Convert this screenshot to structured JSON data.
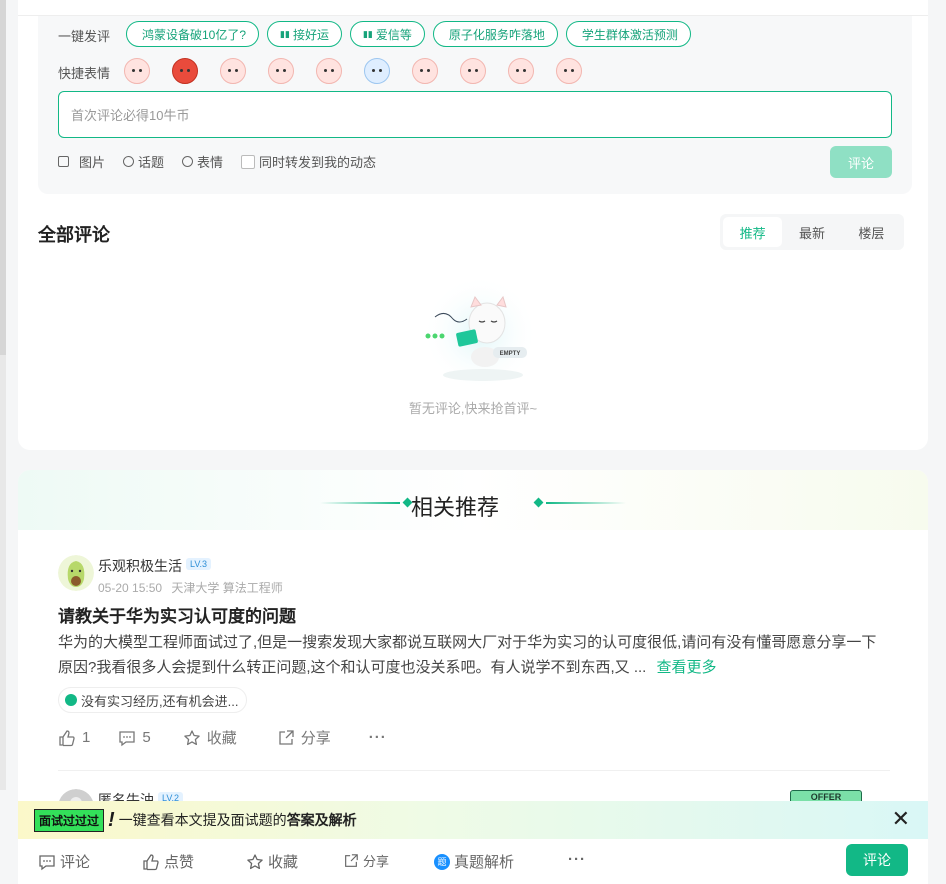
{
  "compose": {
    "quick_label": "一键发评",
    "quick_tags": [
      {
        "text": "鸿蒙设备破10亿了?",
        "badge": ""
      },
      {
        "text": "接好运",
        "badge": "▮▮"
      },
      {
        "text": "爱信等",
        "badge": "▮▮"
      },
      {
        "text": "原子化服务咋落地",
        "badge": ""
      },
      {
        "text": "学生群体激活预测",
        "badge": ""
      }
    ],
    "emoji_label": "快捷表情",
    "input_placeholder": "首次评论必得10牛币",
    "tool_image": "图片",
    "tool_topic": "话题",
    "tool_emoji": "表情",
    "repost_label": "同时转发到我的动态",
    "submit_label": "评论"
  },
  "comments": {
    "title": "全部评论",
    "sort_tabs": [
      "推荐",
      "最新",
      "楼层"
    ],
    "active_sort": "推荐",
    "empty_badge": "EMPTY",
    "empty_text": "暂无评论,快来抢首评~"
  },
  "recommend": {
    "title": "相关推荐",
    "post": {
      "author": "乐观积极生活",
      "level": "LV.3",
      "time": "05-20 15:50",
      "school": "天津大学 算法工程师",
      "title": "请教关于华为实习认可度的问题",
      "body": "华为的大模型工程师面试过了,但是一搜索发现大家都说互联网大厂对于华为实习的认可度很低,请问有没有懂哥愿意分享一下原因?我看很多人会提到什么转正问题,这个和认可度也没关系吧。有人说学不到东西,又 ...",
      "more": "查看更多",
      "tag": "没有实习经历,还有机会进...",
      "likes": "1",
      "comments": "5",
      "collect": "收藏",
      "share": "分享",
      "more_icon": "···"
    },
    "next_author": "匿名牛油",
    "next_level": "LV.2",
    "next_badge": "OFFER"
  },
  "banner": {
    "tag": "面试过过过",
    "bang": "!",
    "text": "一键查看本文提及面试题的",
    "highlight": "答案及解析"
  },
  "bottom_bar": {
    "comment": "评论",
    "like": "点赞",
    "collect": "收藏",
    "share": "分享",
    "analysis_badge": "题",
    "analysis": "真题解析",
    "more": "···",
    "submit": "评论"
  }
}
